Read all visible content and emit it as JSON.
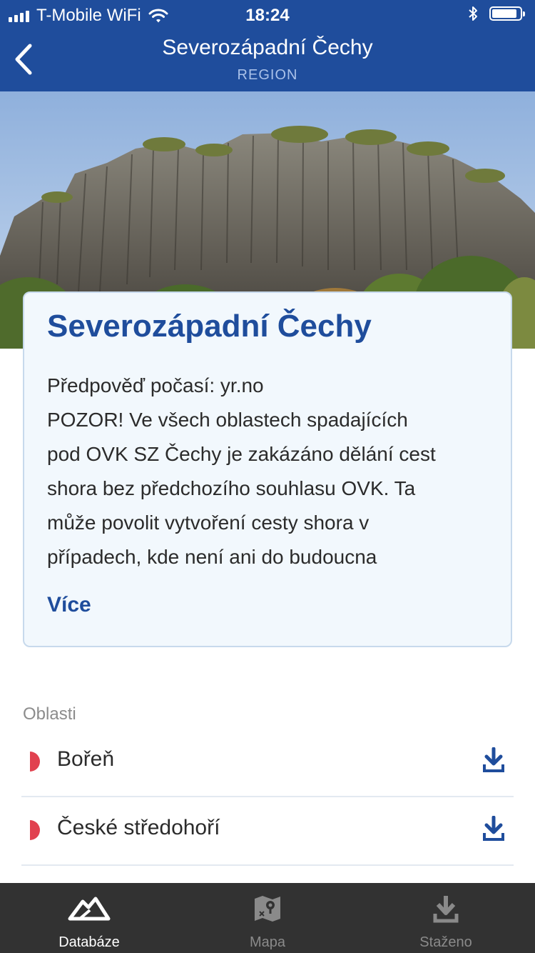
{
  "status_bar": {
    "carrier": "T-Mobile WiFi",
    "time": "18:24",
    "battery_percent": 90
  },
  "header": {
    "title": "Severozápadní Čechy",
    "subtitle": "REGION"
  },
  "region_card": {
    "title": "Severozápadní Čechy",
    "description_lines": [
      "Předpověď počasí: yr.no",
      "POZOR! Ve všech oblastech spadajících",
      "pod OVK SZ Čechy je zakázáno dělání cest",
      "shora bez předchozího souhlasu OVK. Ta",
      "může povolit vytvoření cesty shora v",
      "případech, kde není ani do budoucna"
    ],
    "more_label": "Více"
  },
  "areas": {
    "section_label": "Oblasti",
    "items": [
      {
        "label": "Bořeň"
      },
      {
        "label": "České středohoří"
      }
    ]
  },
  "tab_bar": {
    "tabs": [
      {
        "label": "Databáze",
        "icon": "mountain-icon",
        "active": true
      },
      {
        "label": "Mapa",
        "icon": "map-pin-icon",
        "active": false
      },
      {
        "label": "Staženo",
        "icon": "download-icon",
        "active": false
      }
    ]
  },
  "colors": {
    "brand_blue": "#1f4d9c",
    "accent_red": "#e1414f",
    "tab_bar_bg": "#323232",
    "tab_active": "#ffffff",
    "tab_inactive": "#8a8a8a"
  }
}
